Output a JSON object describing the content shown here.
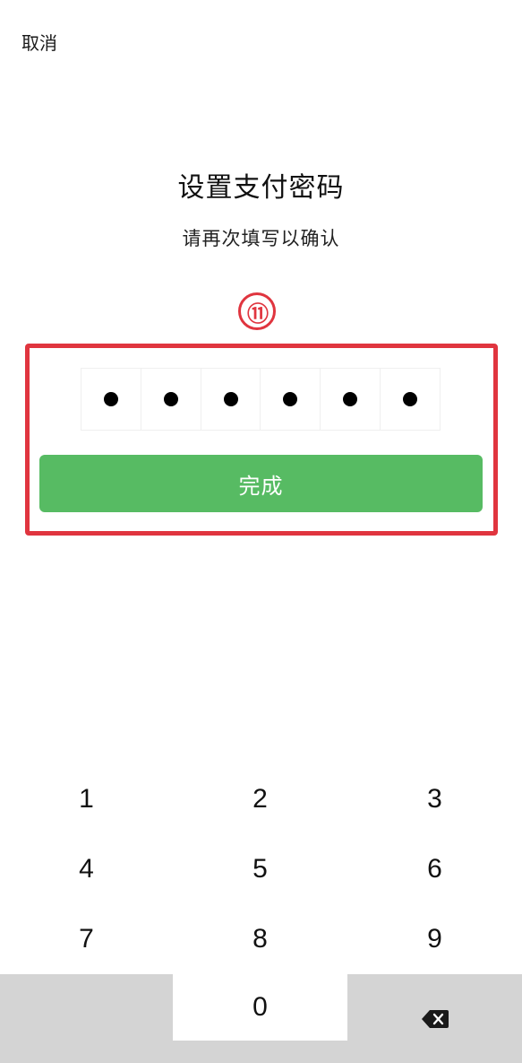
{
  "header": {
    "cancel_label": "取消"
  },
  "main": {
    "title": "设置支付密码",
    "subtitle": "请再次填写以确认",
    "step_marker": "⑪",
    "pin_filled_count": 6,
    "done_label": "完成"
  },
  "keypad": {
    "keys": [
      "1",
      "2",
      "3",
      "4",
      "5",
      "6",
      "7",
      "8",
      "9",
      "",
      "0",
      "delete-icon"
    ]
  },
  "colors": {
    "primary_green": "#57bb63",
    "annotation_red": "#e0353f",
    "keypad_gray": "#d4d4d4"
  }
}
